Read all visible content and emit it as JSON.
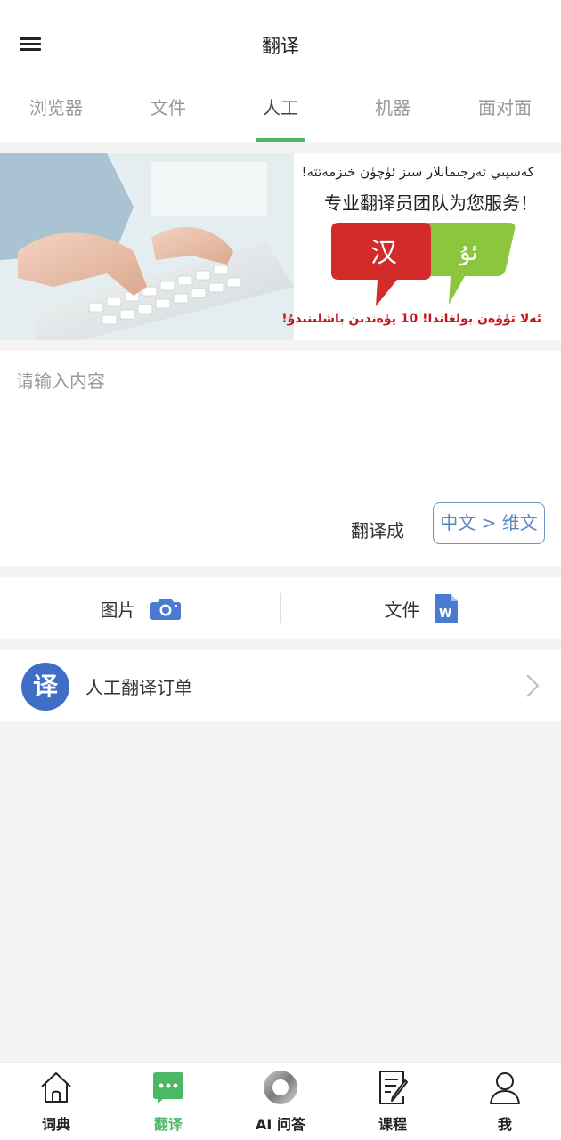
{
  "header": {
    "title": "翻译"
  },
  "tabs": [
    {
      "label": "浏览器",
      "active": false
    },
    {
      "label": "文件",
      "active": false
    },
    {
      "label": "人工",
      "active": true
    },
    {
      "label": "机器",
      "active": false
    },
    {
      "label": "面对面",
      "active": false
    }
  ],
  "banner": {
    "ug_top": "كەسپىي تەرجىمانلار سىز ئۈچۈن خىزمەتتە!",
    "cn_line": "专业翻译员团队为您服务！",
    "bubble_left": "汉",
    "bubble_right": "ئۇ",
    "ug_bottom": "ئەلا تۈۋەن بولغاندا! 10 يۈەندىن باشلىنىدۇ!"
  },
  "input": {
    "placeholder": "请输入内容",
    "value": "",
    "translate_to_label": "翻译成",
    "language_pair": "中文 > 维文"
  },
  "attach": {
    "image_label": "图片",
    "image_icon": "camera-icon",
    "file_label": "文件",
    "file_icon": "word-doc-icon"
  },
  "order": {
    "icon_text": "译",
    "label": "人工翻译订单"
  },
  "bottom_nav": [
    {
      "label": "词典",
      "icon": "home-icon",
      "active": false
    },
    {
      "label": "翻译",
      "icon": "chat-bubble-icon",
      "active": true
    },
    {
      "label": "AI 问答",
      "icon": "ai-ring-icon",
      "active": false
    },
    {
      "label": "课程",
      "icon": "notebook-pen-icon",
      "active": false
    },
    {
      "label": "我",
      "icon": "user-icon",
      "active": false
    }
  ],
  "colors": {
    "accent_green": "#4cb866",
    "link_blue": "#5a87c2",
    "order_icon_blue": "#3f6ec7",
    "bubble_red": "#d32a2a",
    "bubble_green": "#8cc63f"
  }
}
